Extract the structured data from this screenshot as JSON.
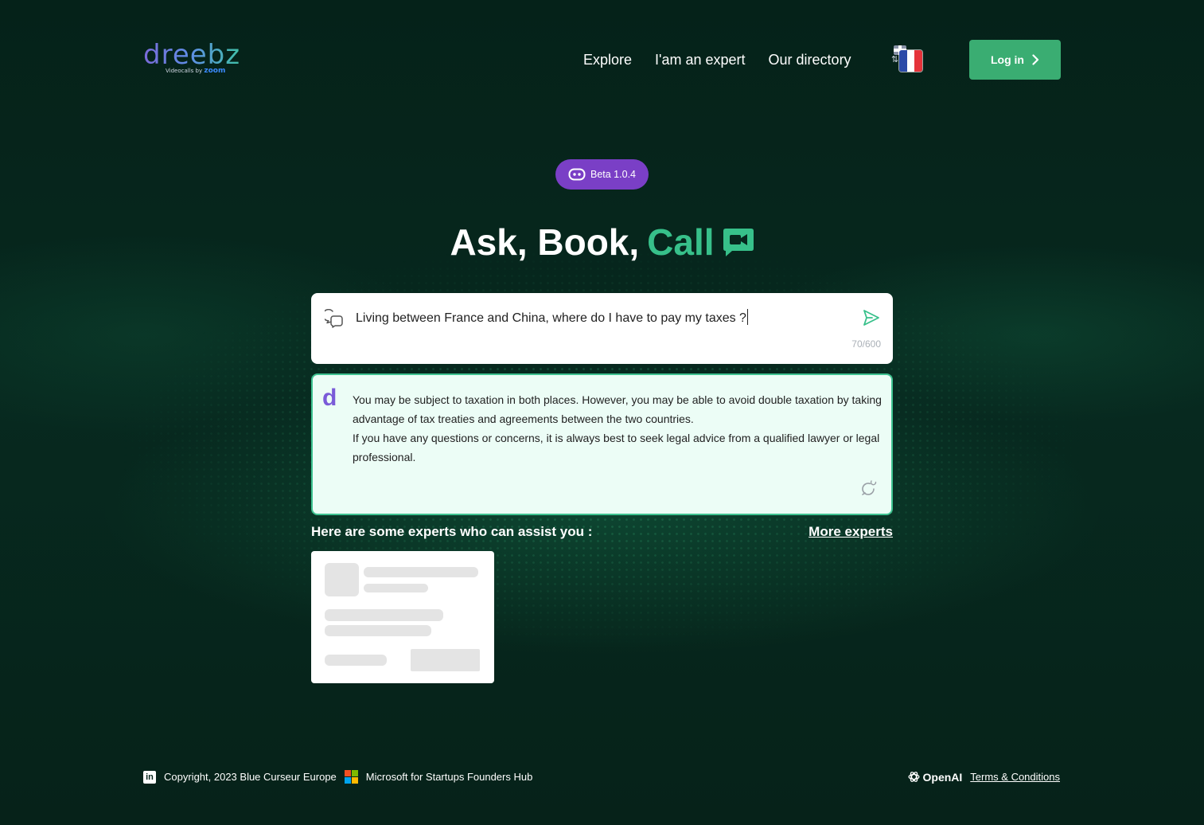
{
  "brand": {
    "name": "dreebz",
    "tagline": "Videocalls by",
    "partner": "zoom"
  },
  "nav": {
    "items": [
      "Explore",
      "I'am an expert",
      "Our directory"
    ],
    "language": "French",
    "login_label": "Log in"
  },
  "hero": {
    "beta_label": "Beta 1.0.4",
    "title_part1": "Ask, Book,",
    "title_accent": "Call"
  },
  "ask": {
    "query": "Living between France and China, where do I have to pay my taxes ?",
    "counter": "70/600"
  },
  "answer": {
    "paragraph1": "You may be subject to taxation in both places. However, you may be able to avoid double taxation by taking advantage of tax treaties and agreements between the two countries.",
    "paragraph2": "If you have any questions or concerns, it is always best to seek legal advice from a qualified lawyer or legal professional."
  },
  "experts": {
    "heading": "Here are some experts who can assist you :",
    "more_label": "More experts"
  },
  "footer": {
    "copyright": "Copyright, 2023 Blue Curseur Europe",
    "microsoft": "Microsoft for Startups Founders Hub",
    "openai": "OpenAI",
    "terms": "Terms & Conditions"
  },
  "colors": {
    "background": "#06261d",
    "accent_green": "#37c08a",
    "login_green": "#3aad72",
    "beta_purple": "#7a3fc6",
    "answer_bg": "#ecfdf6"
  },
  "icons": [
    "chat-bubbles-icon",
    "send-icon",
    "dreebz-d-icon",
    "regenerate-icon",
    "video-chat-icon",
    "robot-icon",
    "linkedin-icon",
    "microsoft-icon",
    "openai-icon",
    "chevron-right-icon"
  ]
}
